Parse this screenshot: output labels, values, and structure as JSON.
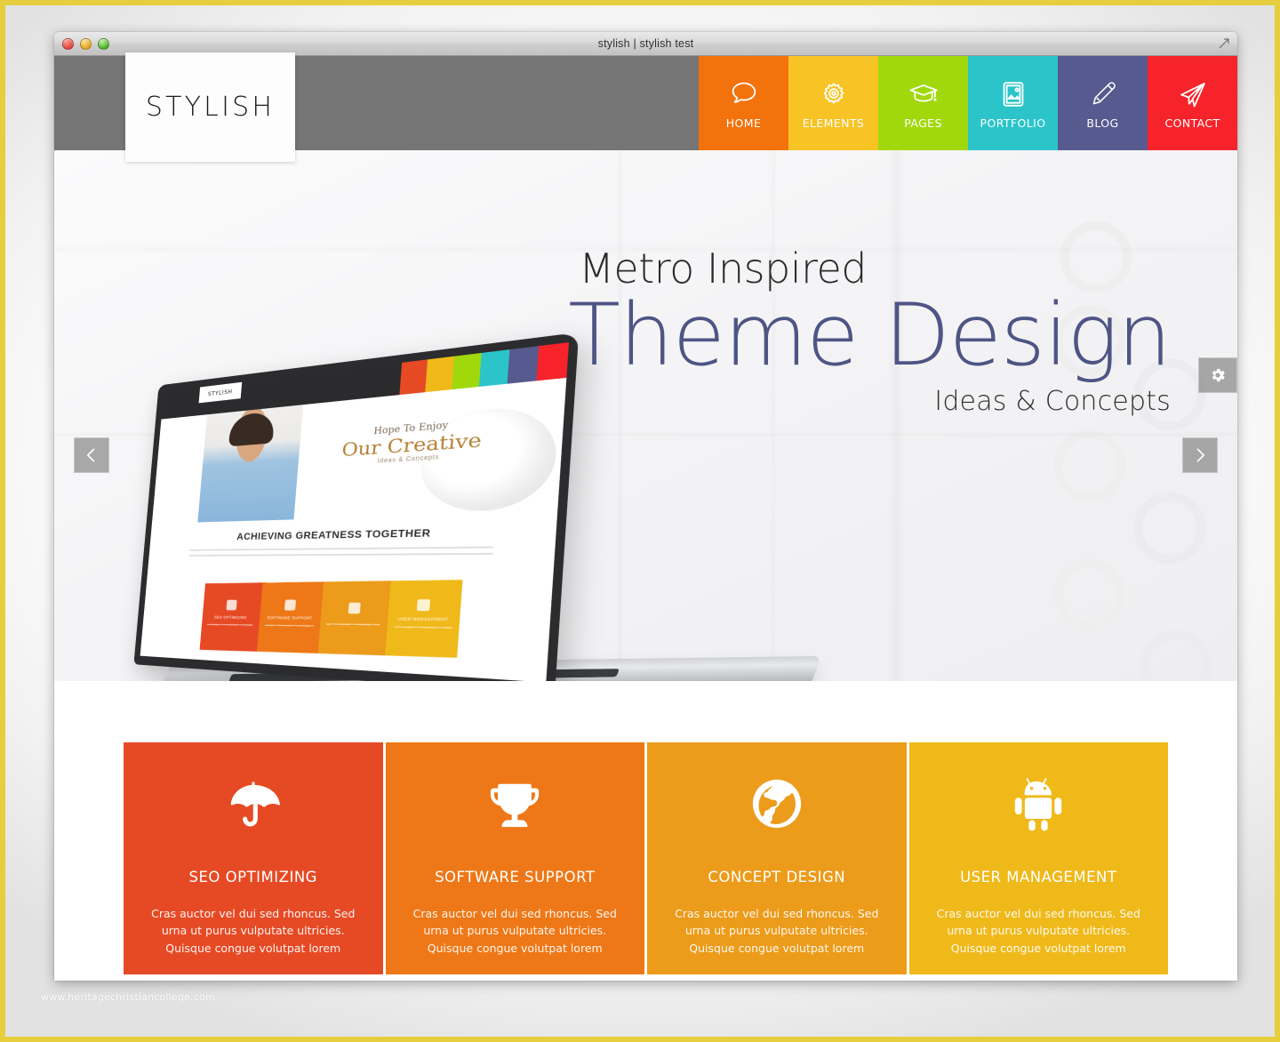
{
  "window": {
    "title": "stylish | stylish test",
    "controls": {
      "close": "close",
      "minimize": "minimize",
      "zoom": "zoom"
    }
  },
  "site": {
    "logo": "STYLISH",
    "nav": [
      {
        "label": "HOME",
        "icon": "speech-bubble-icon",
        "color": "#F2720C"
      },
      {
        "label": "ELEMENTS",
        "icon": "gear-icon",
        "color": "#F7C325"
      },
      {
        "label": "PAGES",
        "icon": "graduation-cap-icon",
        "color": "#A1D80B"
      },
      {
        "label": "PORTFOLIO",
        "icon": "image-icon",
        "color": "#2BC4C9"
      },
      {
        "label": "BLOG",
        "icon": "pencil-icon",
        "color": "#575A8E"
      },
      {
        "label": "CONTACT",
        "icon": "paper-plane-icon",
        "color": "#F7232B"
      }
    ]
  },
  "hero": {
    "line1": "Metro Inspired",
    "line2": "Theme Design",
    "line3": "Ideas & Concepts",
    "prev_label": "Previous slide",
    "next_label": "Next slide",
    "settings_label": "Slider settings",
    "laptop_mock": {
      "logo": "STYLISH",
      "eyebrow": "Hope To Enjoy",
      "headline": "Our Creative",
      "subline": "Ideas & Concepts",
      "section_title": "ACHIEVING GREATNESS TOGETHER",
      "tiles": [
        {
          "label": "SEO OPTIMIZING",
          "color": "#E64A25"
        },
        {
          "label": "SOFTWARE SUPPORT",
          "color": "#EE7817"
        },
        {
          "label": "",
          "color": "#EC9B1A"
        },
        {
          "label": "USER MANAGEMENT",
          "color": "#F0B91A"
        }
      ],
      "nav_colors": [
        "#E64A25",
        "#F0B91A",
        "#A1D80B",
        "#2BC4C9",
        "#575A8E",
        "#F7232B"
      ]
    }
  },
  "features": [
    {
      "title": "SEO OPTIMIZING",
      "icon": "umbrella-icon",
      "color": "#E64A25",
      "desc": "Cras auctor vel dui sed rhoncus. Sed urna ut purus vulputate ultricies. Quisque congue volutpat lorem"
    },
    {
      "title": "SOFTWARE SUPPORT",
      "icon": "trophy-icon",
      "color": "#EE7817",
      "desc": "Cras auctor vel dui sed rhoncus. Sed urna ut purus vulputate ultricies. Quisque congue volutpat lorem"
    },
    {
      "title": "CONCEPT DESIGN",
      "icon": "globe-icon",
      "color": "#EC9B1A",
      "desc": "Cras auctor vel dui sed rhoncus. Sed urna ut purus vulputate ultricies. Quisque congue volutpat lorem"
    },
    {
      "title": "USER MANAGEMENT",
      "icon": "android-icon",
      "color": "#F0B91A",
      "desc": "Cras auctor vel dui sed rhoncus. Sed urna ut purus vulputate ultricies. Quisque congue volutpat lorem"
    }
  ],
  "watermark": "www.heritagechristiancollege.com",
  "colors": {
    "header_gray": "#757575",
    "hero_heading": "#4E5585",
    "page_border": "#E6CE3E"
  }
}
